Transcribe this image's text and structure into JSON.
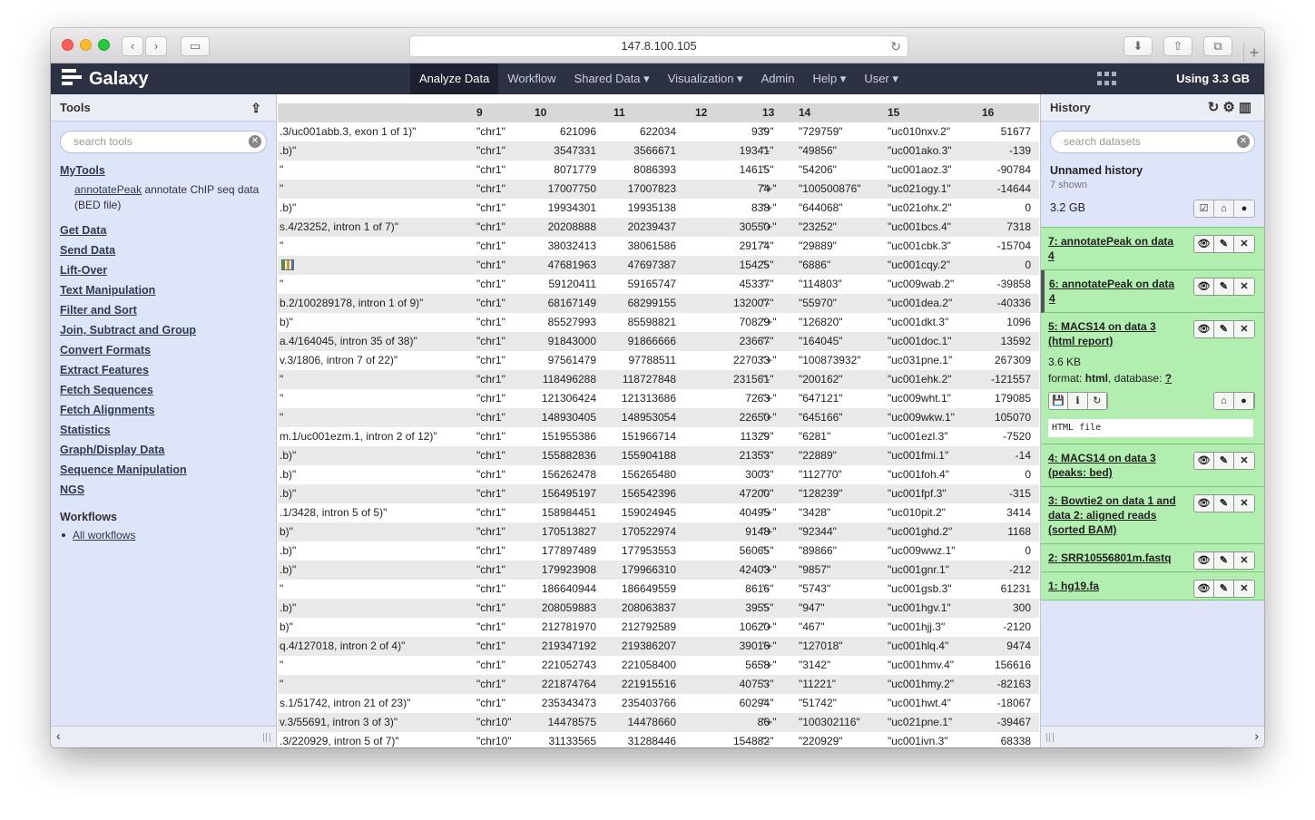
{
  "browser": {
    "url": "147.8.100.105"
  },
  "masthead": {
    "brand": "Galaxy",
    "nav": [
      "Analyze Data",
      "Workflow",
      "Shared Data ▾",
      "Visualization ▾",
      "Admin",
      "Help ▾",
      "User ▾"
    ],
    "quota": "Using 3.3 GB"
  },
  "tools": {
    "title": "Tools",
    "search_placeholder": "search tools",
    "sections": [
      "MyTools",
      "Get Data",
      "Send Data",
      "Lift-Over",
      "Text Manipulation",
      "Filter and Sort",
      "Join, Subtract and Group",
      "Convert Formats",
      "Extract Features",
      "Fetch Sequences",
      "Fetch Alignments",
      "Statistics",
      "Graph/Display Data",
      "Sequence Manipulation",
      "NGS"
    ],
    "mytool": {
      "link": "annotatePeak",
      "desc": " annotate ChIP seq data (BED file)"
    },
    "workflows_title": "Workflows",
    "workflows_link": "All workflows"
  },
  "table": {
    "headers": [
      "9",
      "10",
      "11",
      "12",
      "13",
      "14",
      "15",
      "16"
    ],
    "rows": [
      [
        ".3/uc001abb.3, exon 1 of 1)\"",
        "\"chr1\"",
        "621096",
        "622034",
        "939",
        "\"-\"",
        "\"729759\"",
        "\"uc010nxv.2\"",
        "51677"
      ],
      [
        ".b)\"",
        "\"chr1\"",
        "3547331",
        "3566671",
        "19341",
        "\"-\"",
        "\"49856\"",
        "\"uc001ako.3\"",
        "-139"
      ],
      [
        "\"",
        "\"chr1\"",
        "8071779",
        "8086393",
        "14615",
        "\"-\"",
        "\"54206\"",
        "\"uc001aoz.3\"",
        "-90784"
      ],
      [
        "\"",
        "\"chr1\"",
        "17007750",
        "17007823",
        "74",
        "\"+\"",
        "\"100500876\"",
        "\"uc021ogy.1\"",
        "-14644"
      ],
      [
        ".b)\"",
        "\"chr1\"",
        "19934301",
        "19935138",
        "838",
        "\"+\"",
        "\"644068\"",
        "\"uc021ohx.2\"",
        "0"
      ],
      [
        "s.4/23252, intron 1 of 7)\"",
        "\"chr1\"",
        "20208888",
        "20239437",
        "30550",
        "\"+\"",
        "\"23252\"",
        "\"uc001bcs.4\"",
        "7318"
      ],
      [
        "\"",
        "\"chr1\"",
        "38032413",
        "38061586",
        "29174",
        "\"-\"",
        "\"29889\"",
        "\"uc001cbk.3\"",
        "-15704"
      ],
      [
        "",
        "\"chr1\"",
        "47681963",
        "47697387",
        "15425",
        "\"-\"",
        "\"6886\"",
        "\"uc001cqy.2\"",
        "0"
      ],
      [
        "\"",
        "\"chr1\"",
        "59120411",
        "59165747",
        "45337",
        "\"-\"",
        "\"114803\"",
        "\"uc009wab.2\"",
        "-39858"
      ],
      [
        "b.2/100289178, intron 1 of 9)\"",
        "\"chr1\"",
        "68167149",
        "68299155",
        "132007",
        "\"-\"",
        "\"55970\"",
        "\"uc001dea.2\"",
        "-40336"
      ],
      [
        "b)\"",
        "\"chr1\"",
        "85527993",
        "85598821",
        "70829",
        "\"+\"",
        "\"126820\"",
        "\"uc001dkt.3\"",
        "1096"
      ],
      [
        "a.4/164045, intron 35 of 38)\"",
        "\"chr1\"",
        "91843000",
        "91866666",
        "23667",
        "\"-\"",
        "\"164045\"",
        "\"uc001doc.1\"",
        "13592"
      ],
      [
        "v.3/1806, intron 7 of 22)\"",
        "\"chr1\"",
        "97561479",
        "97788511",
        "227033",
        "\"+\"",
        "\"100873932\"",
        "\"uc031pne.1\"",
        "267309"
      ],
      [
        "\"",
        "\"chr1\"",
        "118496288",
        "118727848",
        "231561",
        "\"-\"",
        "\"200162\"",
        "\"uc001ehk.2\"",
        "-121557"
      ],
      [
        "\"",
        "\"chr1\"",
        "121306424",
        "121313686",
        "7263",
        "\"+\"",
        "\"647121\"",
        "\"uc009wht.1\"",
        "179085"
      ],
      [
        "\"",
        "\"chr1\"",
        "148930405",
        "148953054",
        "22650",
        "\"+\"",
        "\"645166\"",
        "\"uc009wkw.1\"",
        "105070"
      ],
      [
        "m.1/uc001ezm.1, intron 2 of 12)\"",
        "\"chr1\"",
        "151955386",
        "151966714",
        "11329",
        "\"-\"",
        "\"6281\"",
        "\"uc001ezl.3\"",
        "-7520"
      ],
      [
        ".b)\"",
        "\"chr1\"",
        "155882836",
        "155904188",
        "21353",
        "\"-\"",
        "\"22889\"",
        "\"uc001fmi.1\"",
        "-14"
      ],
      [
        ".b)\"",
        "\"chr1\"",
        "156262478",
        "156265480",
        "3003",
        "\"-\"",
        "\"112770\"",
        "\"uc001foh.4\"",
        "0"
      ],
      [
        ".b)\"",
        "\"chr1\"",
        "156495197",
        "156542396",
        "47200",
        "\"-\"",
        "\"128239\"",
        "\"uc001fpf.3\"",
        "-315"
      ],
      [
        ".1/3428, intron 5 of 5)\"",
        "\"chr1\"",
        "158984451",
        "159024945",
        "40495",
        "\"+\"",
        "\"3428\"",
        "\"uc010pit.2\"",
        "3414"
      ],
      [
        "b)\"",
        "\"chr1\"",
        "170513827",
        "170522974",
        "9148",
        "\"+\"",
        "\"92344\"",
        "\"uc001ghd.2\"",
        "1168"
      ],
      [
        ".b)\"",
        "\"chr1\"",
        "177897489",
        "177953553",
        "56065",
        "\"-\"",
        "\"89866\"",
        "\"uc009wwz.1\"",
        "0"
      ],
      [
        ".b)\"",
        "\"chr1\"",
        "179923908",
        "179966310",
        "42403",
        "\"+\"",
        "\"9857\"",
        "\"uc001gnr.1\"",
        "-212"
      ],
      [
        "\"",
        "\"chr1\"",
        "186640944",
        "186649559",
        "8616",
        "\"-\"",
        "\"5743\"",
        "\"uc001gsb.3\"",
        "61231"
      ],
      [
        ".b)\"",
        "\"chr1\"",
        "208059883",
        "208063837",
        "3955",
        "\"-\"",
        "\"947\"",
        "\"uc001hgv.1\"",
        "300"
      ],
      [
        "b)\"",
        "\"chr1\"",
        "212781970",
        "212792589",
        "10620",
        "\"+\"",
        "\"467\"",
        "\"uc001hjj.3\"",
        "-2120"
      ],
      [
        "q.4/127018, intron 2 of 4)\"",
        "\"chr1\"",
        "219347192",
        "219386207",
        "39016",
        "\"+\"",
        "\"127018\"",
        "\"uc001hlq.4\"",
        "9474"
      ],
      [
        "\"",
        "\"chr1\"",
        "221052743",
        "221058400",
        "5658",
        "\"+\"",
        "\"3142\"",
        "\"uc001hmv.4\"",
        "156616"
      ],
      [
        "\"",
        "\"chr1\"",
        "221874764",
        "221915516",
        "40753",
        "\"-\"",
        "\"11221\"",
        "\"uc001hmy.2\"",
        "-82163"
      ],
      [
        "s.1/51742, intron 21 of 23)\"",
        "\"chr1\"",
        "235343473",
        "235403766",
        "60294",
        "\"-\"",
        "\"51742\"",
        "\"uc001hwt.4\"",
        "-18067"
      ],
      [
        "v.3/55691, intron 3 of 3)\"",
        "\"chr10\"",
        "14478575",
        "14478660",
        "86",
        "\"+\"",
        "\"100302116\"",
        "\"uc021pne.1\"",
        "-39467"
      ],
      [
        ".3/220929, intron 5 of 7)\"",
        "\"chr10\"",
        "31133565",
        "31288446",
        "154882",
        "\"-\"",
        "\"220929\"",
        "\"uc001ivn.3\"",
        "68338"
      ]
    ]
  },
  "history": {
    "title": "History",
    "search_placeholder": "search datasets",
    "name": "Unnamed history",
    "shown": "7 shown",
    "size": "3.2 GB",
    "datasets": [
      {
        "title": "7: annotatePeak on data 4"
      },
      {
        "title": "6: annotatePeak on data 4"
      },
      {
        "title": "5: MACS14 on data 3 (html report)",
        "size": "3.6 KB",
        "format_label": "format: ",
        "format": "html",
        "db_label": ", database: ",
        "db": "?",
        "peek": "HTML file"
      },
      {
        "title": "4: MACS14 on data 3 (peaks: bed)"
      },
      {
        "title": "3: Bowtie2 on data 1 and data 2: aligned reads (sorted BAM)"
      },
      {
        "title": "2: SRR10556801m.fastq"
      },
      {
        "title": "1: hg19.fa"
      }
    ]
  },
  "colors": {
    "masthead": "#2c3143",
    "panel": "#dfe5f9",
    "dataset_ok": "#b2eeaf"
  }
}
